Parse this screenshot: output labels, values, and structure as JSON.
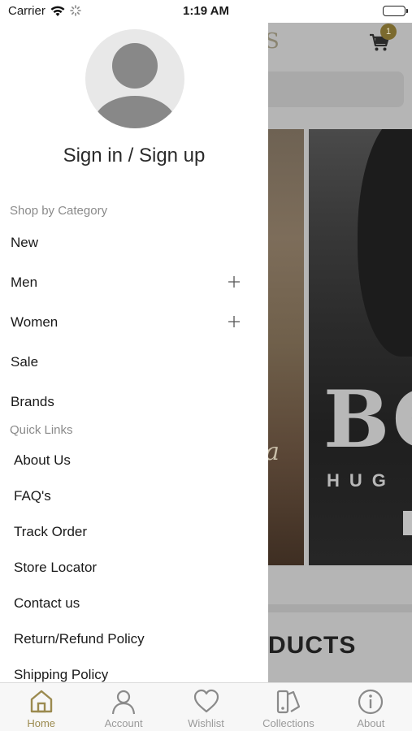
{
  "status_bar": {
    "carrier": "Carrier",
    "time": "1:19 AM"
  },
  "background": {
    "logo_fragment": "S",
    "cart_badge": "1",
    "banner_script": "a",
    "brand": "BO",
    "brand_sub": "HUG",
    "section_heading": "DUCTS"
  },
  "drawer": {
    "sign_in_label": "Sign in / Sign up",
    "shop_by_category_title": "Shop by Category",
    "categories": [
      {
        "label": "New",
        "expandable": false
      },
      {
        "label": "Men",
        "expandable": true
      },
      {
        "label": "Women",
        "expandable": true
      },
      {
        "label": "Sale",
        "expandable": false
      },
      {
        "label": "Brands",
        "expandable": false
      }
    ],
    "quick_links_title": "Quick Links",
    "quick_links": [
      "About Us",
      "FAQ's",
      "Track Order",
      "Store Locator",
      "Contact us",
      "Return/Refund Policy",
      "Shipping Policy"
    ]
  },
  "tab_bar": {
    "tabs": [
      {
        "label": "Home",
        "icon": "home-icon",
        "active": true
      },
      {
        "label": "Account",
        "icon": "account-icon",
        "active": false
      },
      {
        "label": "Wishlist",
        "icon": "heart-icon",
        "active": false
      },
      {
        "label": "Collections",
        "icon": "collections-icon",
        "active": false
      },
      {
        "label": "About",
        "icon": "info-icon",
        "active": false
      }
    ]
  },
  "colors": {
    "accent": "#9b8a4f",
    "inactive": "#9a9a9a",
    "overlay": "#b5b5b5"
  }
}
